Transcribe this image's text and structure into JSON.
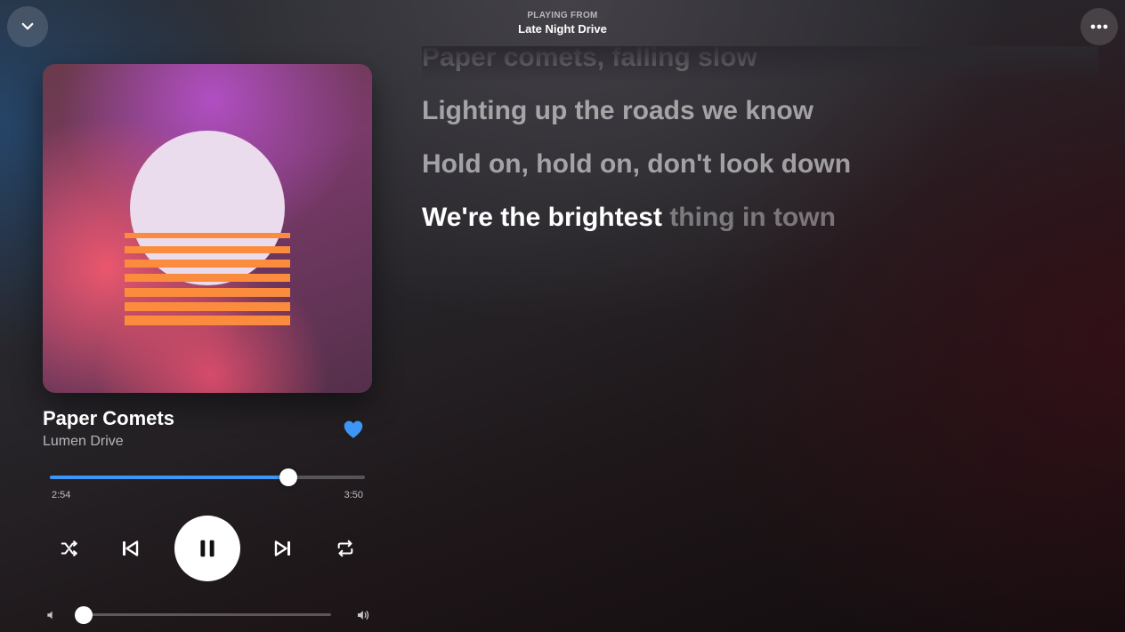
{
  "header": {
    "playing_from_label": "PLAYING FROM",
    "playlist_name": "Late Night Drive"
  },
  "track": {
    "title": "Paper Comets",
    "artist": "Lumen Drive",
    "liked": true,
    "like_color": "#3d95f5"
  },
  "progress": {
    "elapsed": "2:54",
    "total": "3:50",
    "fraction": 0.757,
    "accent_color": "#3d95f5"
  },
  "controls": {
    "shuffle_icon": "shuffle-icon",
    "previous_icon": "skip-previous-icon",
    "play_state": "playing",
    "pause_icon": "pause-icon",
    "next_icon": "skip-next-icon",
    "repeat_icon": "repeat-icon"
  },
  "volume": {
    "level": 0.0,
    "low_icon": "volume-low-icon",
    "high_icon": "volume-high-icon"
  },
  "lyrics": {
    "lines": [
      "Paper comets, falling slow",
      "Lighting up the roads we know",
      "Hold on, hold on, don't look down"
    ],
    "current": {
      "sung": "We're the brightest",
      "unsung": "thing in town"
    }
  }
}
